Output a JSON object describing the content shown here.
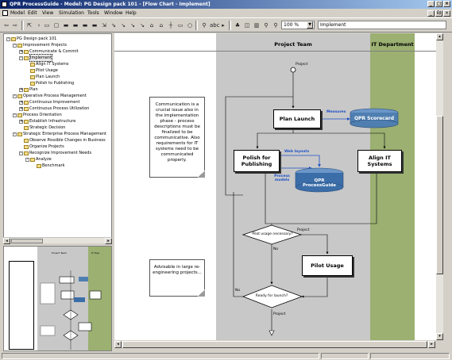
{
  "window": {
    "title": "QPR ProcessGuide - Model: PG Design pack 101 - [Flow Chart - Implement]",
    "buttons": [
      "_",
      "□",
      "×"
    ],
    "child_buttons": [
      "_",
      "₪",
      "×"
    ]
  },
  "menu": [
    "Model",
    "Edit",
    "View",
    "Simulation",
    "Tools",
    "Window",
    "Help"
  ],
  "toolbar": {
    "zoom": "100 %",
    "name_field": "Implement"
  },
  "tree": {
    "items": [
      {
        "label": "PG Design pack 101",
        "indent": 0,
        "exp": "-"
      },
      {
        "label": "Improvement Projects",
        "indent": 1,
        "exp": "-"
      },
      {
        "label": "Communicate & Commit",
        "indent": 2,
        "exp": "+"
      },
      {
        "label": "Implement",
        "indent": 2,
        "exp": "-",
        "selected": true
      },
      {
        "label": "Align IT Systems",
        "indent": 3,
        "exp": ""
      },
      {
        "label": "Pilot Usage",
        "indent": 3,
        "exp": ""
      },
      {
        "label": "Plan Launch",
        "indent": 3,
        "exp": ""
      },
      {
        "label": "Polish to Publishing",
        "indent": 3,
        "exp": ""
      },
      {
        "label": "Plan",
        "indent": 2,
        "exp": "+"
      },
      {
        "label": "Operative Process Management",
        "indent": 1,
        "exp": "-"
      },
      {
        "label": "Continuous Improvement",
        "indent": 2,
        "exp": "+"
      },
      {
        "label": "Continuous Process Utilization",
        "indent": 2,
        "exp": "+"
      },
      {
        "label": "Process Orientation",
        "indent": 1,
        "exp": "-"
      },
      {
        "label": "Establish Infrastructure",
        "indent": 2,
        "exp": "+"
      },
      {
        "label": "Strategic Decision",
        "indent": 2,
        "exp": ""
      },
      {
        "label": "Strategic Enterprise Process Management",
        "indent": 1,
        "exp": "-"
      },
      {
        "label": "Observe Possible Changes in Business",
        "indent": 2,
        "exp": ""
      },
      {
        "label": "Organize Projects",
        "indent": 2,
        "exp": ""
      },
      {
        "label": "Recognize Improvement Needs",
        "indent": 2,
        "exp": "-"
      },
      {
        "label": "Analyze",
        "indent": 3,
        "exp": "-"
      },
      {
        "label": "Benchmark",
        "indent": 4,
        "exp": ""
      }
    ]
  },
  "overview": {
    "lane1": "Project Team",
    "lane2": "IT Dep."
  },
  "flowchart": {
    "lanes": {
      "project_team": "Project Team",
      "it_department": "IT Department"
    },
    "start_label": "Project",
    "end_label": "Project",
    "note1": "Communication is a crucial issue also in the implementation phase - process descriptions must be finalized to be communicative. Also requirements for IT systems need to be communicated properly.",
    "note2": "Advisable in large re-engineering projects...",
    "plan_launch": "Plan Launch",
    "scorecard": "QPR Scorecard",
    "measures": "Measures",
    "polish": "Polish for Publishing",
    "web_layouts": "Web layouts",
    "process_models": "Process models",
    "processguide": "QPR ProcessGuide",
    "align_it": "Align IT Systems",
    "pilot_decision": "Pilot usage necessary?",
    "pilot_yes": "Project",
    "pilot_no": "No",
    "pilot_usage": "Pilot Usage",
    "ready_decision": "Ready for launch?",
    "ready_no": "No"
  },
  "colors": {
    "project_team_lane": "#c8c8c8",
    "it_lane": "#9bb071",
    "scorecard": "#4f7fb0",
    "processguide": "#3b6ea8",
    "title_start": "#0a246a",
    "title_end": "#a6caf0"
  }
}
